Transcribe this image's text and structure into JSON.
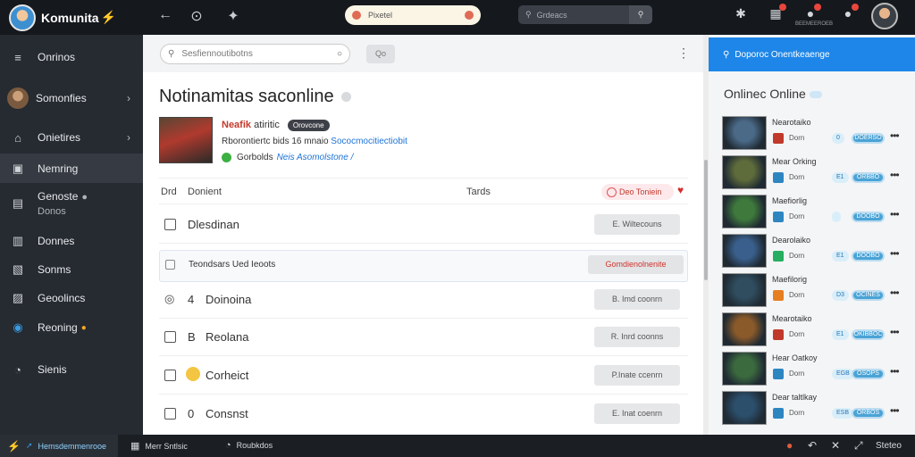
{
  "app": {
    "name": "Komunita",
    "bolt": "⚡"
  },
  "topbar": {
    "back_icon": "←",
    "history_icon": "⊙",
    "pin_icon": "✦",
    "pill_text": "Pixetel",
    "search_placeholder": "Grdeacs",
    "icons": {
      "puzzle": "✱",
      "grid": "▦",
      "notifications": "●",
      "notifications_sub": "BEEMEEROEB",
      "alerts": "●"
    }
  },
  "sidebar": {
    "items": [
      {
        "label": "Onrinos",
        "icon": "≡"
      },
      {
        "label": "Somonfies",
        "icon": ""
      },
      {
        "label": "Onietires",
        "icon": "⌂"
      },
      {
        "label": "Nemring",
        "icon": "▣"
      },
      {
        "label": "Genoste",
        "label2": "Donos",
        "icon": "▤"
      },
      {
        "label": "Donnes",
        "icon": "▥"
      },
      {
        "label": "Sonms",
        "icon": "▧"
      },
      {
        "label": "Geoolincs",
        "icon": "▨"
      },
      {
        "label": "Reoning",
        "icon": "◉"
      },
      {
        "label": "Sienis",
        "icon": "◔"
      }
    ]
  },
  "main": {
    "search_placeholder": "Sesfiennoutibotns",
    "toolbar_button": "Qo",
    "more": "⋮",
    "title": "Notinamitas saconline",
    "post": {
      "name": "Neafik",
      "name_rest": "atiritic",
      "tag": "Orovcone",
      "desc": "Rborontiertc bids 16 mnaio",
      "desc_link": "Sococmocitiectiobit",
      "status": "Gorbolds",
      "status_link": "Neis Asomolstone /"
    },
    "table": {
      "col1": "Drd",
      "col2": "Donient",
      "col3": "Tards",
      "col4": "Deo Toniein",
      "heart": "♥"
    },
    "rows": [
      {
        "glyph": "",
        "label": "Dlesdinan",
        "button": "E. Wiltecouns"
      },
      {
        "glyph": "",
        "label": "Teondsars Ued Ieoots",
        "button": "Gomdienolnenite"
      },
      {
        "glyph": "◎",
        "num": "4",
        "label": "Doinoina",
        "button": "B. Imd coonrn"
      },
      {
        "glyph": "",
        "num": "B",
        "label": "Reolana",
        "button": "R. Inrd coonns"
      },
      {
        "glyph": "",
        "num": "",
        "label": "Corheict",
        "button": "P.Inate ccenrn"
      },
      {
        "glyph": "",
        "num": "0",
        "label": "Consnst",
        "button": "E. Inat coenrn"
      }
    ]
  },
  "right": {
    "banner": "Doporoc Onentkeaenge",
    "title": "Onlinec Online",
    "items": [
      {
        "name": "Nearotaiko",
        "sub": "Dorn",
        "tag1": "0",
        "tag2": "DOERSO",
        "color": "#4b6a88",
        "sm": "#c0392b"
      },
      {
        "name": "Mear Orking",
        "sub": "Dorn",
        "tag1": "E1",
        "tag2": "ORBBO",
        "color": "#5e6b3a",
        "sm": "#2e86c1"
      },
      {
        "name": "Maefiorlig",
        "sub": "Dorn",
        "tag1": "",
        "tag2": "DOOBO",
        "color": "#3f7a3c",
        "sm": "#2e86c1"
      },
      {
        "name": "Dearolaiko",
        "sub": "Dorn",
        "tag1": "E1",
        "tag2": "DOOBO",
        "color": "#3a5f8c",
        "sm": "#27ae60"
      },
      {
        "name": "Maefilorig",
        "sub": "Dorn",
        "tag1": "D3",
        "tag2": "OCINES",
        "color": "#2f4d5e",
        "sm": "#e67e22"
      },
      {
        "name": "Mearotaiko",
        "sub": "Dorn",
        "tag1": "E1",
        "tag2": "OKIBBOC",
        "color": "#8a5a2a",
        "sm": "#c0392b"
      },
      {
        "name": "Hear Oatkoy",
        "sub": "Dorn",
        "tag1": "EGB",
        "tag2": "OSOPS",
        "color": "#3c6a3f",
        "sm": "#2e86c1"
      },
      {
        "name": "Dear taltlkay",
        "sub": "Dorn",
        "tag1": "ESB",
        "tag2": "ORBOS",
        "color": "#2c4f6c",
        "sm": "#2e86c1"
      }
    ]
  },
  "bottombar": {
    "left": "Hemsdemmenrooe",
    "item1": "Merr Sntlsic",
    "item2": "Roubkdos",
    "right_label": "Steteo"
  }
}
